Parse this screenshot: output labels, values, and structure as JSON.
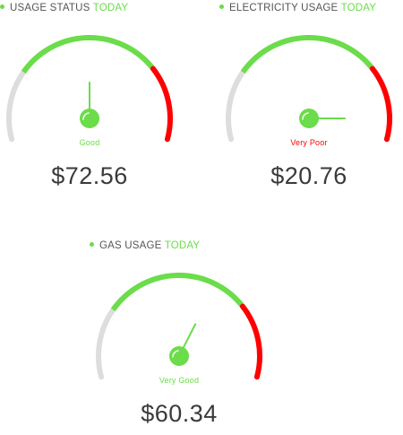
{
  "colors": {
    "accent": "#6bdc4a",
    "track": "#dddddd",
    "danger": "#ff0000",
    "text": "#333333"
  },
  "gauges": [
    {
      "title": "USAGE STATUS",
      "title_accent": "TODAY",
      "status": "Good",
      "status_color": "#6bdc4a",
      "amount": "$72.56",
      "needle_level": 0.5
    },
    {
      "title": "ELECTRICITY USAGE",
      "title_accent": "TODAY",
      "status": "Very Poor",
      "status_color": "#ff0000",
      "amount": "$20.76",
      "needle_level": 1.0
    },
    {
      "title": "GAS USAGE",
      "title_accent": "TODAY",
      "status": "Very Good",
      "status_color": "#6bdc4a",
      "amount": "$60.34",
      "needle_level": 0.65
    }
  ]
}
